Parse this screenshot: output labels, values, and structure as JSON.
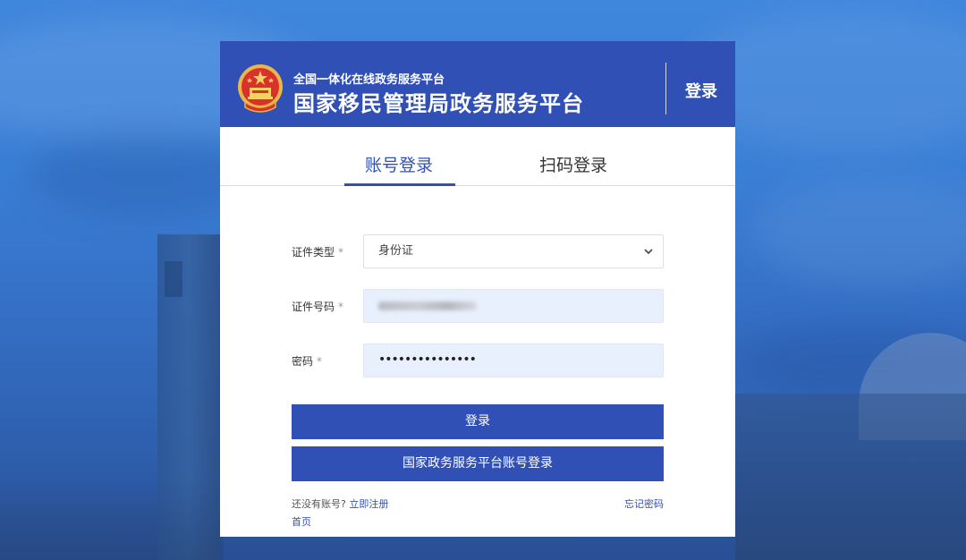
{
  "header": {
    "subtitle": "全国一体化在线政务服务平台",
    "title": "国家移民管理局政务服务平台",
    "login_label": "登录",
    "emblem_icon": "national-emblem-icon",
    "bg_color": "#3150b6"
  },
  "tabs": [
    {
      "label": "账号登录",
      "active": true
    },
    {
      "label": "扫码登录",
      "active": false
    }
  ],
  "form": {
    "id_type": {
      "label": "证件类型",
      "required_mark": "*",
      "value": "身份证"
    },
    "id_number": {
      "label": "证件号码",
      "required_mark": "*",
      "value_obscured": true
    },
    "password": {
      "label": "密码",
      "required_mark": "*",
      "value": "•••••••••••••••"
    }
  },
  "buttons": {
    "login": "登录",
    "gov_platform_login": "国家政务服务平台账号登录"
  },
  "links": {
    "no_account_prompt": "还没有账号?",
    "register": "立即注册",
    "forgot_password": "忘记密码",
    "home": "首页"
  },
  "colors": {
    "accent": "#3150b6",
    "filled_field": "#e9f0fd"
  }
}
